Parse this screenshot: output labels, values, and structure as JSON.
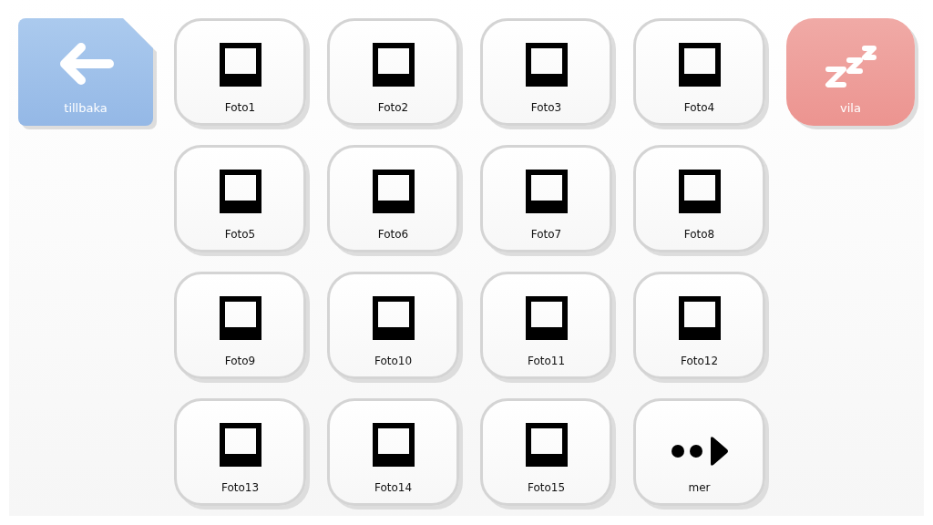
{
  "back_button": {
    "label": "tillbaka"
  },
  "sleep_button": {
    "label": "vila"
  },
  "tiles": [
    {
      "kind": "photo",
      "label": "Foto1"
    },
    {
      "kind": "photo",
      "label": "Foto2"
    },
    {
      "kind": "photo",
      "label": "Foto3"
    },
    {
      "kind": "photo",
      "label": "Foto4"
    },
    {
      "kind": "photo",
      "label": "Foto5"
    },
    {
      "kind": "photo",
      "label": "Foto6"
    },
    {
      "kind": "photo",
      "label": "Foto7"
    },
    {
      "kind": "photo",
      "label": "Foto8"
    },
    {
      "kind": "photo",
      "label": "Foto9"
    },
    {
      "kind": "photo",
      "label": "Foto10"
    },
    {
      "kind": "photo",
      "label": "Foto11"
    },
    {
      "kind": "photo",
      "label": "Foto12"
    },
    {
      "kind": "photo",
      "label": "Foto13"
    },
    {
      "kind": "photo",
      "label": "Foto14"
    },
    {
      "kind": "photo",
      "label": "Foto15"
    },
    {
      "kind": "more",
      "label": "mer"
    }
  ]
}
